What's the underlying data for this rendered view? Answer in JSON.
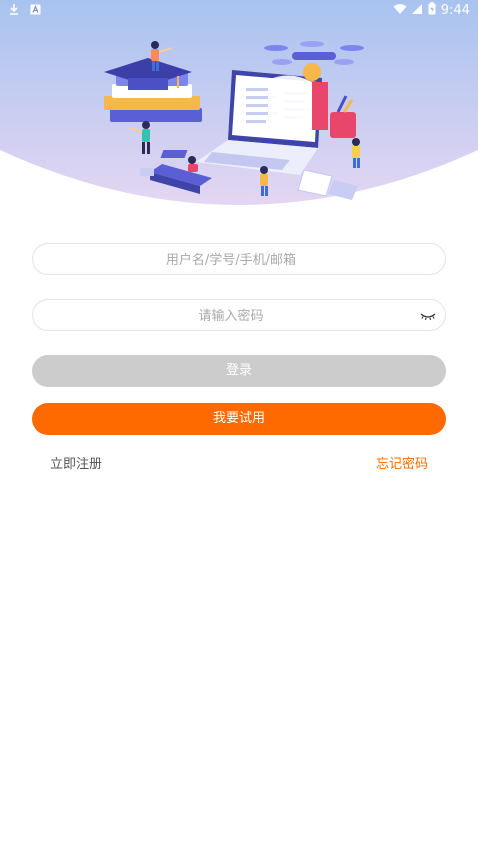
{
  "status_bar": {
    "time": "9:44",
    "icons": [
      "download-icon",
      "a-badge-icon",
      "wifi-icon",
      "signal-icon",
      "battery-icon"
    ]
  },
  "form": {
    "username_placeholder": "用户名/学号/手机/邮箱",
    "password_placeholder": "请输入密码",
    "login_label": "登录",
    "trial_label": "我要试用",
    "register_label": "立即注册",
    "forgot_label": "忘记密码"
  },
  "colors": {
    "accent": "#ff6a00",
    "login_disabled": "#cccccc",
    "hero_top": "#a8c3f0",
    "hero_bottom": "#e3d6f1"
  }
}
